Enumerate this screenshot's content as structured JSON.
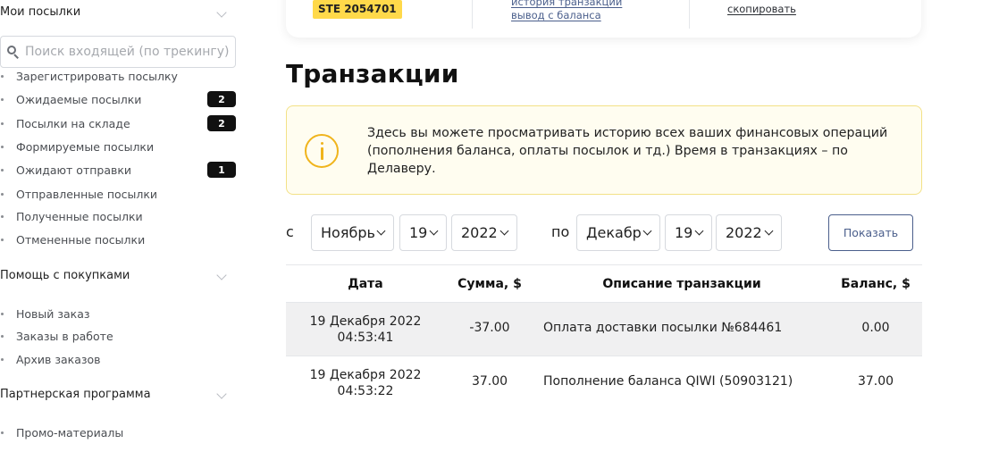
{
  "sidebar": {
    "sections": [
      {
        "title": "Мои посылки"
      },
      {
        "title": "Помощь с покупками"
      },
      {
        "title": "Партнерская программа"
      }
    ],
    "search": {
      "placeholder": "Поиск входящей (по трекингу)"
    },
    "parcels_items": [
      {
        "label": "Зарегистрировать посылку"
      },
      {
        "label": "Ожидаемые посылки",
        "badge": "2"
      },
      {
        "label": "Посылки на складе",
        "badge": "2"
      },
      {
        "label": "Формируемые посылки"
      },
      {
        "label": "Ожидают отправки",
        "badge": "1"
      },
      {
        "label": "Отправленные посылки"
      },
      {
        "label": "Полученные посылки"
      },
      {
        "label": "Отмененные посылки"
      }
    ],
    "purchase_items": [
      {
        "label": "Новый заказ"
      },
      {
        "label": "Заказы в работе"
      },
      {
        "label": "Архив заказов"
      }
    ],
    "partner_items": [
      {
        "label": "Промо-материалы"
      }
    ]
  },
  "top_card": {
    "code": "STE 2054701",
    "history_link": "история транзакций",
    "withdraw_link": "вывод с баланса",
    "copy_link": "скопировать"
  },
  "page": {
    "title": "Транзакции",
    "info": "Здесь вы можете просматривать историю всех ваших финансовых операций (пополнения баланса, оплаты посылок и тд.) Время в транзакциях – по Делаверу."
  },
  "filter": {
    "from_label": "с",
    "to_label": "по",
    "from_month": "Ноябрь",
    "from_day": "19",
    "from_year": "2022",
    "to_month": "Декабрь",
    "to_day": "19",
    "to_year": "2022",
    "show_button": "Показать"
  },
  "table": {
    "headers": {
      "date": "Дата",
      "amount": "Сумма, $",
      "description": "Описание транзакции",
      "balance": "Баланс, $"
    },
    "rows": [
      {
        "date": "19 Декабря 2022",
        "time": "04:53:41",
        "amount": "-37.00",
        "description": "Оплата доставки посылки №684461",
        "balance": "0.00"
      },
      {
        "date": "19 Декабря 2022",
        "time": "04:53:22",
        "amount": "37.00",
        "description": "Пополнение баланса QIWI (50903121)",
        "balance": "37.00"
      }
    ]
  },
  "colors": {
    "accent": "#4b5f8c",
    "badge_bg": "#111111",
    "code_badge": "#ffd94a",
    "info_icon": "#f0b41c"
  }
}
